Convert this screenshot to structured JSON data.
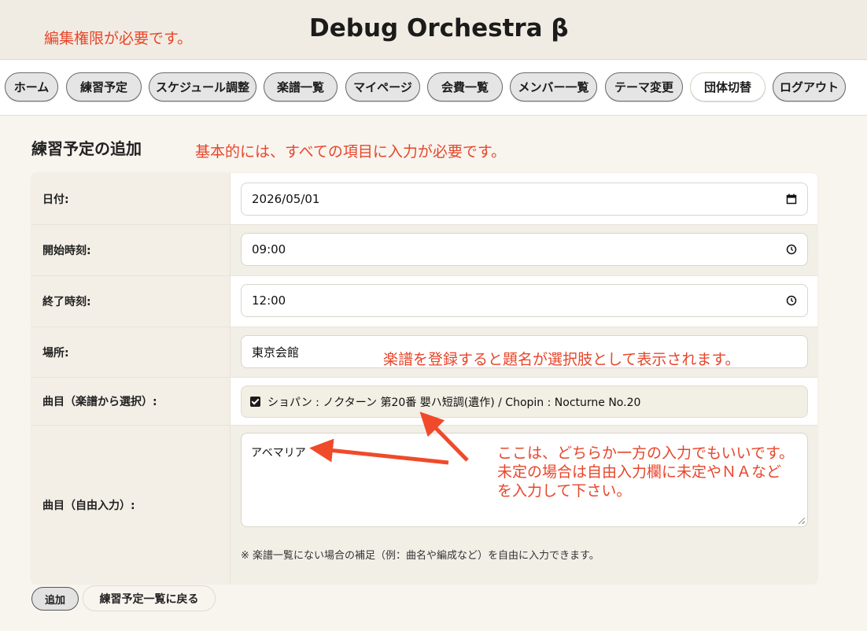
{
  "header": {
    "auth_note": "編集権限が必要です。",
    "title": "Debug Orchestra β"
  },
  "nav": {
    "items": [
      {
        "label": "ホーム"
      },
      {
        "label": "練習予定"
      },
      {
        "label": "スケジュール調整"
      },
      {
        "label": "楽譜一覧"
      },
      {
        "label": "マイページ"
      },
      {
        "label": "会費一覧"
      },
      {
        "label": "メンバー一覧"
      },
      {
        "label": "テーマ変更"
      },
      {
        "label": "団体切替",
        "active": true
      },
      {
        "label": "ログアウト"
      }
    ]
  },
  "page": {
    "title": "練習予定の追加",
    "hint_required": "基本的には、すべての項目に入力が必要です。"
  },
  "form": {
    "date": {
      "label": "日付:",
      "value": "2026/05/01",
      "icon": "calendar-icon"
    },
    "start_time": {
      "label": "開始時刻:",
      "value": "09:00",
      "icon": "clock-icon"
    },
    "end_time": {
      "label": "終了時刻:",
      "value": "12:00",
      "icon": "clock-icon"
    },
    "place": {
      "label": "場所:",
      "value": "東京会館"
    },
    "score_select": {
      "label": "曲目（楽譜から選択）:",
      "options": [
        {
          "label": "ショパン : ノクターン 第20番 嬰ハ短調(遺作) / Chopin : Nocturne No.20",
          "checked": true
        }
      ]
    },
    "free_input": {
      "label": "曲目（自由入力）:",
      "value": "アベマリア",
      "note": "※ 楽譜一覧にない場合の補足（例：曲名や編成など）を自由に入力できます。"
    }
  },
  "annotations": {
    "score_note": "楽譜を登録すると題名が選択肢として表示されます。",
    "either_note_lines": [
      "ここは、どちらか一方の入力でもいいです。",
      "未定の場合は自由入力欄に未定やＮＡなど",
      "を入力して下さい。"
    ],
    "color": "#e8452a"
  },
  "actions": {
    "add_label": "追加",
    "back_label": "練習予定一覧に戻る"
  }
}
